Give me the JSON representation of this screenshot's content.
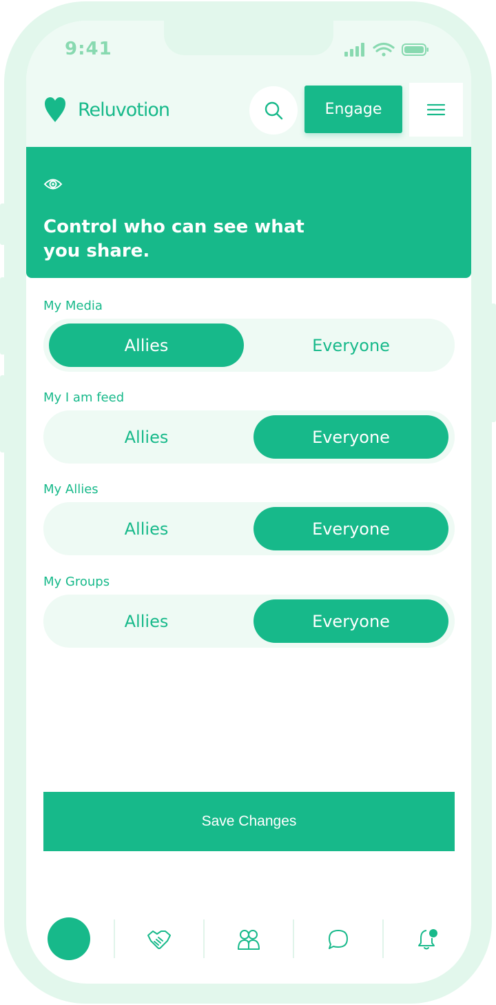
{
  "status_bar": {
    "time": "9:41"
  },
  "header": {
    "brand": "Reluvotion",
    "engage_label": "Engage"
  },
  "banner": {
    "title": "Control who can see what you share."
  },
  "settings": [
    {
      "label": "My Media",
      "options": [
        "Allies",
        "Everyone"
      ],
      "selected": "Allies"
    },
    {
      "label": "My I am feed",
      "options": [
        "Allies",
        "Everyone"
      ],
      "selected": "Everyone"
    },
    {
      "label": "My Allies",
      "options": [
        "Allies",
        "Everyone"
      ],
      "selected": "Everyone"
    },
    {
      "label": "My Groups",
      "options": [
        "Allies",
        "Everyone"
      ],
      "selected": "Everyone"
    }
  ],
  "save_label": "Save Changes",
  "bottom_nav": [
    "avatar",
    "handshake-icon",
    "people-icon",
    "chat-icon",
    "bell-icon"
  ],
  "colors": {
    "accent": "#17b98a",
    "tint": "#eefaf4",
    "frame": "#e2f7ec"
  }
}
